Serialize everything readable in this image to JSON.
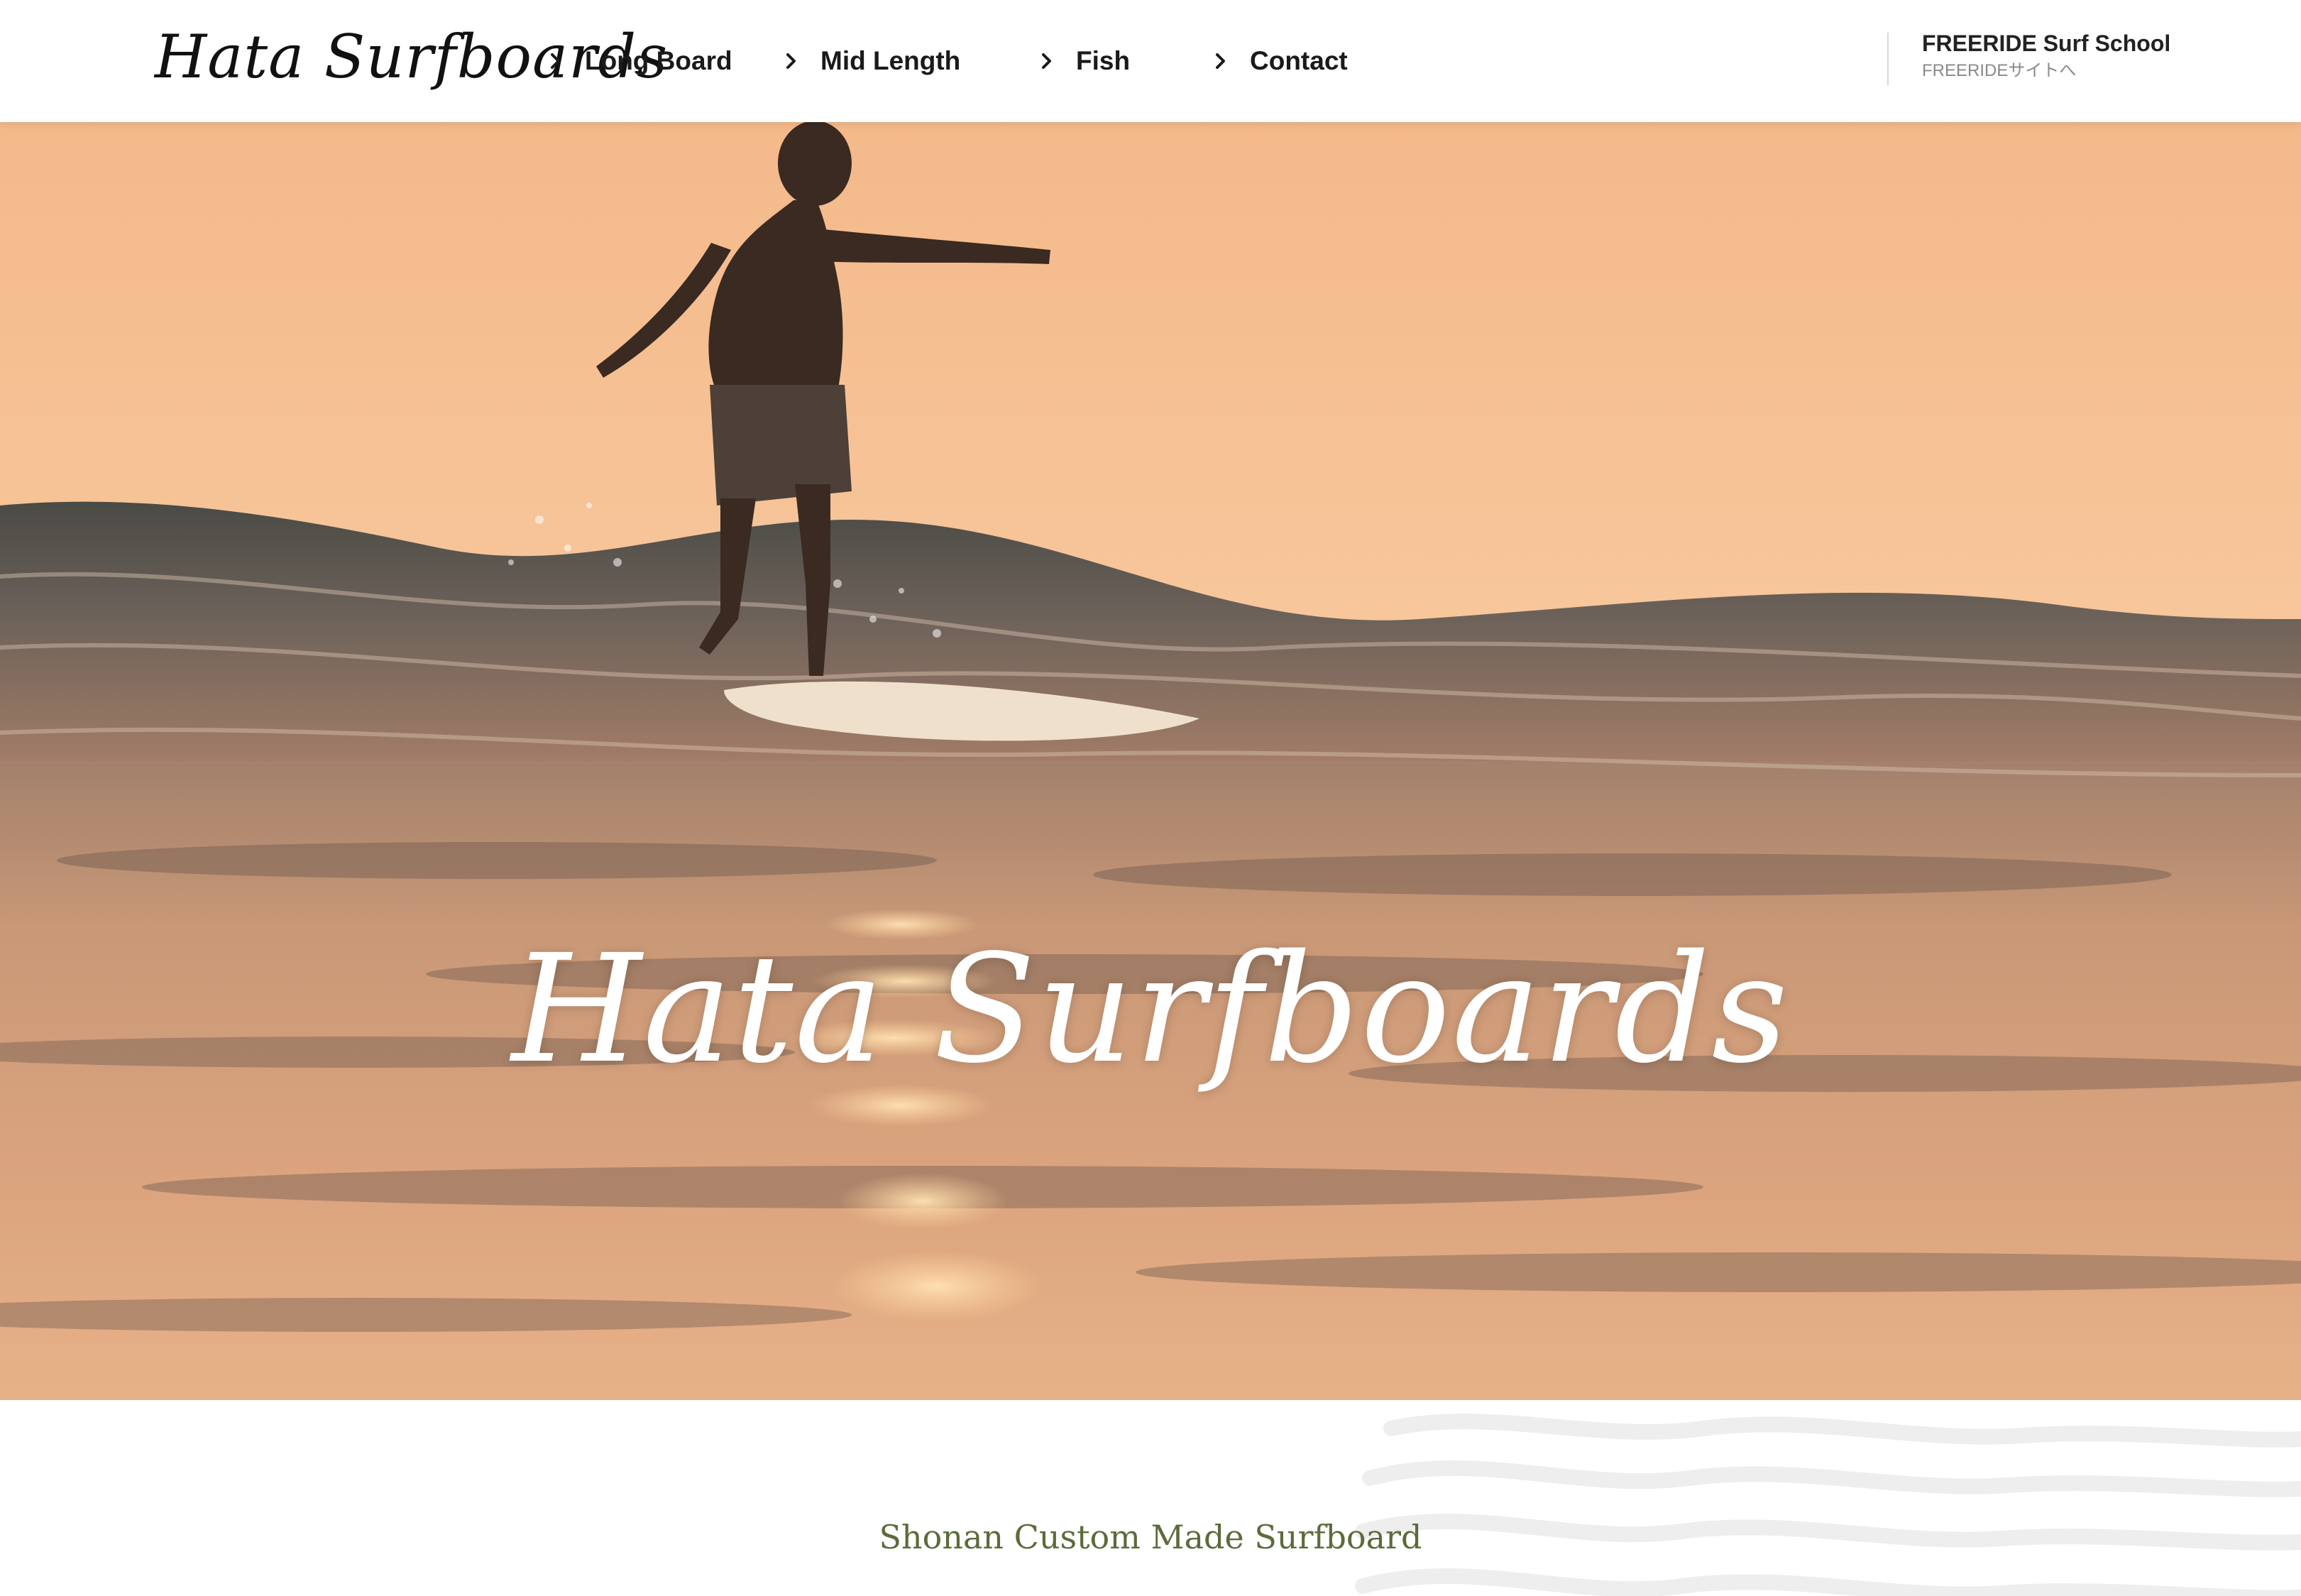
{
  "header": {
    "logo": "Hata Surfboards",
    "nav": [
      {
        "label": "Long Board",
        "icon": "chevron-right-icon"
      },
      {
        "label": "Mid Length",
        "icon": "chevron-right-icon"
      },
      {
        "label": "Fish",
        "icon": "chevron-right-icon"
      },
      {
        "label": "Contact",
        "icon": "chevron-right-icon"
      }
    ],
    "external": {
      "title": "FREERIDE Surf School",
      "subtitle": "FREERIDEサイトへ"
    }
  },
  "hero": {
    "title": "Hata Surfboards",
    "image": "sunset-surfer-on-wave"
  },
  "intro": {
    "tagline": "Shonan Custom Made Surfboard"
  },
  "colors": {
    "tagline": "#5c6b3a",
    "sky": "#f6c59c",
    "water": "#3b3a3a"
  }
}
